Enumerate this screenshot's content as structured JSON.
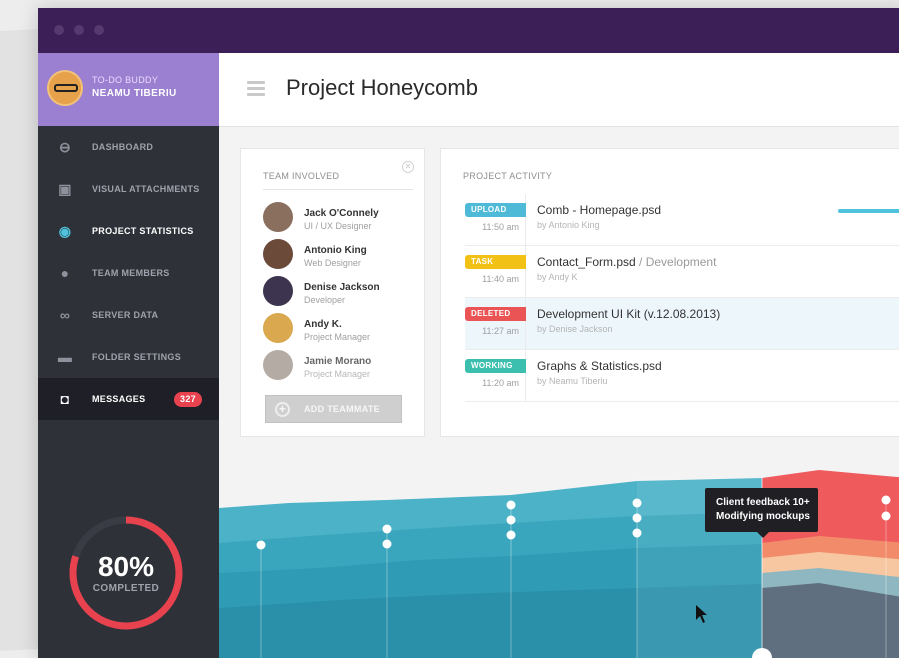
{
  "app": {
    "name": "TO-DO BUDDY",
    "user": "NEAMU TIBERIU"
  },
  "sidebar": {
    "items": [
      {
        "label": "DASHBOARD",
        "icon": "dashboard-icon",
        "glyph": "⊖"
      },
      {
        "label": "VISUAL ATTACHMENTS",
        "icon": "image-icon",
        "glyph": "▣"
      },
      {
        "label": "PROJECT STATISTICS",
        "icon": "eye-icon",
        "glyph": "◉",
        "active": true
      },
      {
        "label": "TEAM MEMBERS",
        "icon": "user-icon",
        "glyph": "●"
      },
      {
        "label": "SERVER DATA",
        "icon": "infinity-icon",
        "glyph": "∞"
      },
      {
        "label": "FOLDER SETTINGS",
        "icon": "folder-icon",
        "glyph": "▬"
      },
      {
        "label": "MESSAGES",
        "icon": "message-icon",
        "glyph": "◘",
        "badge": "327"
      }
    ]
  },
  "progress": {
    "value": "80%",
    "label": "COMPLETED",
    "fraction": 0.8
  },
  "header": {
    "title": "Project Honeycomb"
  },
  "team": {
    "title": "TEAM INVOLVED",
    "members": [
      {
        "name": "Jack O'Connely",
        "role": "UI / UX Designer",
        "color": "#8a6f5e"
      },
      {
        "name": "Antonio King",
        "role": "Web Designer",
        "color": "#6b4a3a"
      },
      {
        "name": "Denise Jackson",
        "role": "Developer",
        "color": "#3d3550"
      },
      {
        "name": "Andy K.",
        "role": "Project Manager",
        "color": "#d9a84f"
      },
      {
        "name": "Jamie Morano",
        "role": "Project Manager",
        "color": "#9b8f86"
      }
    ],
    "add_label": "ADD TEAMMATE"
  },
  "activity": {
    "title": "PROJECT ACTIVITY",
    "rows": [
      {
        "tag": "UPLOAD",
        "tag_color": "#4fb9d8",
        "time": "11:50 am",
        "file": "Comb - Homepage.psd",
        "sub": "",
        "by": "by Antonio King",
        "progress": true
      },
      {
        "tag": "TASK",
        "tag_color": "#f2c115",
        "time": "11:40 am",
        "file": "Contact_Form.psd",
        "sub": " / Development",
        "by": "by Andy K"
      },
      {
        "tag": "DELETED",
        "tag_color": "#ea5455",
        "time": "11:27 am",
        "file": "Development UI Kit (v.12.08.2013)",
        "sub": "",
        "by": "by Denise Jackson",
        "highlight": true
      },
      {
        "tag": "WORKING",
        "tag_color": "#3cbfae",
        "time": "11:20 am",
        "file": "Graphs & Statistics.psd",
        "sub": "",
        "by": "by Neamu Tiberiu"
      }
    ]
  },
  "tooltip": {
    "line1": "Client feedback 10+",
    "line2": "Modifying mockups"
  }
}
